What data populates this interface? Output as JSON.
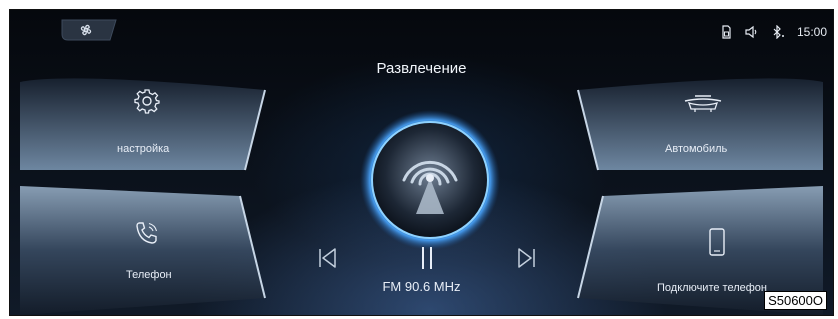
{
  "screen": {
    "title": "Развлечение",
    "time": "15:00",
    "status_icons": [
      "sim-card-icon",
      "volume-icon",
      "bluetooth-icon"
    ],
    "fan_icon": "fan-icon"
  },
  "tiles": {
    "settings": {
      "label": "настройка",
      "icon": "gear-icon"
    },
    "phone": {
      "label": "Телефон",
      "icon": "phone-icon"
    },
    "vehicle": {
      "label": "Автомобиль",
      "icon": "car-icon"
    },
    "connect": {
      "label": "Подключите телефон",
      "icon": "smartphone-icon"
    }
  },
  "player": {
    "station": "FM 90.6 MHz",
    "controls": [
      "previous",
      "play-pause",
      "next"
    ]
  },
  "figure_code": "S50600O",
  "colors": {
    "accent": "#4aa6ff",
    "glow": "#66c3ff",
    "background": "#070b12",
    "text": "#e8eef7"
  }
}
